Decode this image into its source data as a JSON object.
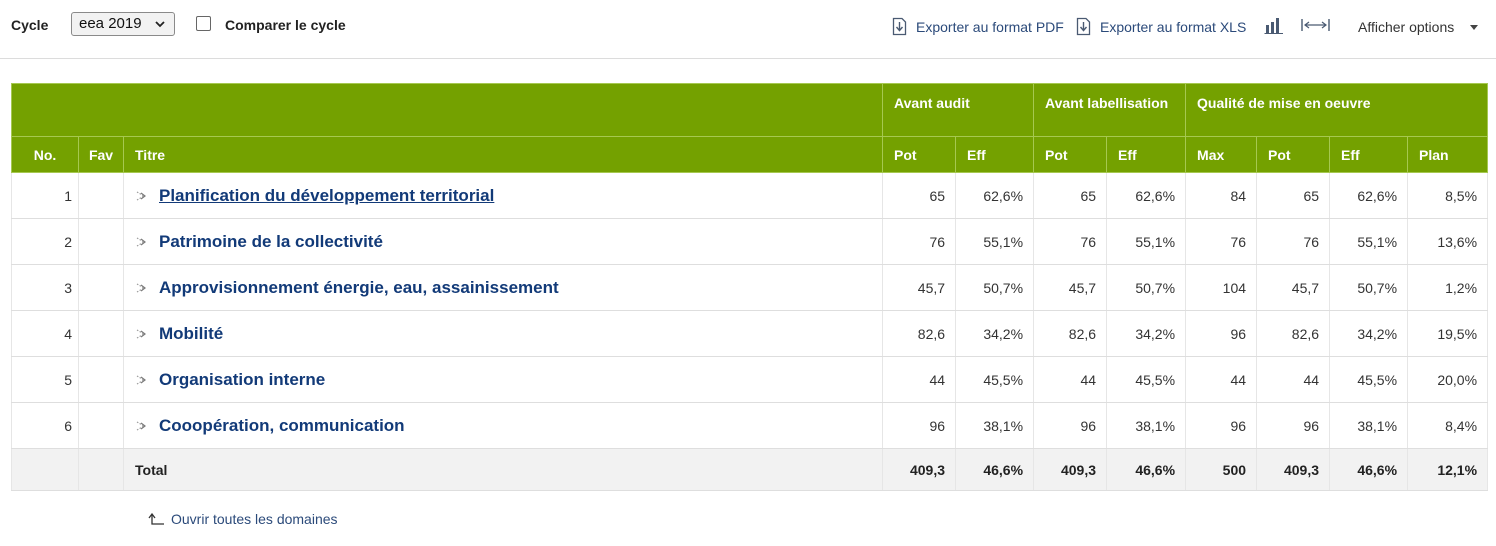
{
  "toolbar": {
    "cycle_label": "Cycle",
    "cycle_value": "eea 2019",
    "compare_label": "Comparer le cycle",
    "export_pdf": "Exporter au format PDF",
    "export_xls": "Exporter au format XLS",
    "options_label": "Afficher options"
  },
  "table": {
    "group_headers": {
      "avant_audit": "Avant audit",
      "avant_labellisation": "Avant labellisation",
      "qualite": "Qualité de mise en oeuvre"
    },
    "columns": {
      "no": "No.",
      "fav": "Fav",
      "titre": "Titre",
      "pot": "Pot",
      "eff": "Eff",
      "max": "Max",
      "plan": "Plan"
    },
    "rows": [
      {
        "no": "1",
        "title": "Planification du développement territorial",
        "aa_pot": "65",
        "aa_eff": "62,6%",
        "al_pot": "65",
        "al_eff": "62,6%",
        "q_max": "84",
        "q_pot": "65",
        "q_eff": "62,6%",
        "q_plan": "8,5%"
      },
      {
        "no": "2",
        "title": "Patrimoine de la collectivité",
        "aa_pot": "76",
        "aa_eff": "55,1%",
        "al_pot": "76",
        "al_eff": "55,1%",
        "q_max": "76",
        "q_pot": "76",
        "q_eff": "55,1%",
        "q_plan": "13,6%"
      },
      {
        "no": "3",
        "title": "Approvisionnement énergie, eau, assainissement",
        "aa_pot": "45,7",
        "aa_eff": "50,7%",
        "al_pot": "45,7",
        "al_eff": "50,7%",
        "q_max": "104",
        "q_pot": "45,7",
        "q_eff": "50,7%",
        "q_plan": "1,2%"
      },
      {
        "no": "4",
        "title": "Mobilité",
        "aa_pot": "82,6",
        "aa_eff": "34,2%",
        "al_pot": "82,6",
        "al_eff": "34,2%",
        "q_max": "96",
        "q_pot": "82,6",
        "q_eff": "34,2%",
        "q_plan": "19,5%"
      },
      {
        "no": "5",
        "title": "Organisation interne",
        "aa_pot": "44",
        "aa_eff": "45,5%",
        "al_pot": "44",
        "al_eff": "45,5%",
        "q_max": "44",
        "q_pot": "44",
        "q_eff": "45,5%",
        "q_plan": "20,0%"
      },
      {
        "no": "6",
        "title": "Cooopération, communication",
        "aa_pot": "96",
        "aa_eff": "38,1%",
        "al_pot": "96",
        "al_eff": "38,1%",
        "q_max": "96",
        "q_pot": "96",
        "q_eff": "38,1%",
        "q_plan": "8,4%"
      }
    ],
    "total": {
      "label": "Total",
      "aa_pot": "409,3",
      "aa_eff": "46,6%",
      "al_pot": "409,3",
      "al_eff": "46,6%",
      "q_max": "500",
      "q_pot": "409,3",
      "q_eff": "46,6%",
      "q_plan": "12,1%"
    }
  },
  "footer": {
    "open_all": "Ouvrir toutes les domaines"
  },
  "colors": {
    "header_green": "#74a100",
    "link_blue": "#123a78",
    "total_bg": "#f2f2f2"
  },
  "icons": [
    "chevron-down-icon",
    "checkbox-icon",
    "pdf-download-icon",
    "xls-download-icon",
    "bar-chart-icon",
    "expand-width-icon",
    "caret-down-icon",
    "expander-arrow-icon",
    "return-arrow-icon"
  ]
}
